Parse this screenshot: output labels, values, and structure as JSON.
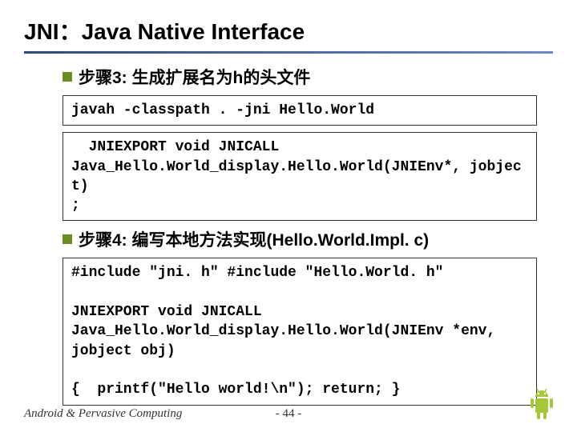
{
  "title": "JNI：Java Native Interface",
  "step3": {
    "heading": "步骤3: 生成扩展名为h的头文件",
    "code1": "javah -classpath . -jni Hello.World",
    "code2": "  JNIEXPORT void JNICALL\nJava_Hello.World_display.Hello.World(JNIEnv*, jobject)\n;"
  },
  "step4": {
    "heading": "步骤4: 编写本地方法实现(Hello.World.Impl. c)",
    "code1": "#include \"jni. h\" #include \"Hello.World. h\"\n\nJNIEXPORT void JNICALL\nJava_Hello.World_display.Hello.World(JNIEnv *env,\njobject obj)\n\n{  printf(\"Hello world!\\n\"); return; }"
  },
  "footer": {
    "left": "Android & Pervasive Computing",
    "page": "- 44 -"
  }
}
